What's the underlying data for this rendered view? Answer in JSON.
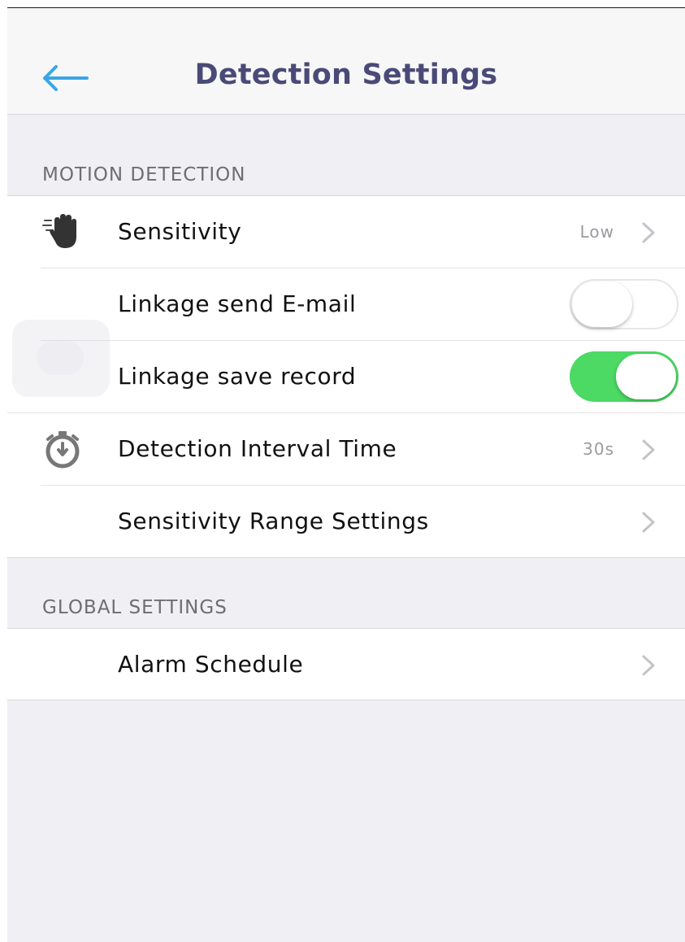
{
  "nav": {
    "title": "Detection Settings",
    "back_icon": "arrow-left-icon",
    "back_color": "#3aa6e8"
  },
  "motion_section": {
    "header": "MOTION DETECTION",
    "rows": [
      {
        "label": "Sensitivity",
        "icon": "hand-icon",
        "detail": "Low"
      },
      {
        "label": "Linkage send E-mail",
        "toggle": false
      },
      {
        "label": "Linkage save record",
        "toggle": true
      },
      {
        "label": "Detection Interval Time",
        "icon": "stopwatch-icon",
        "detail": "30s"
      },
      {
        "label": "Sensitivity Range Settings"
      }
    ]
  },
  "global_section": {
    "header": "GLOBAL SETTINGS",
    "rows": [
      {
        "label": "Alarm Schedule"
      }
    ]
  },
  "colors": {
    "title": "#4a4a78",
    "toggle_on": "#4cd964",
    "background": "#efeff4"
  }
}
